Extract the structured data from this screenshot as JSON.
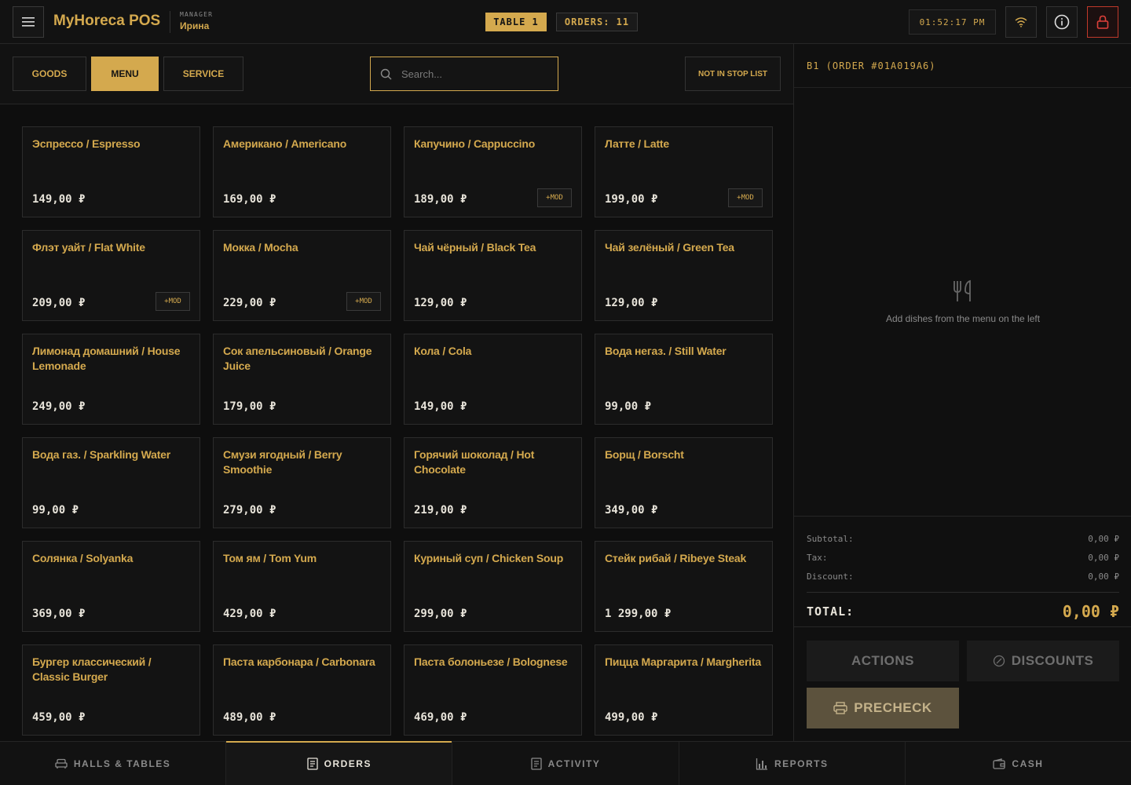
{
  "header": {
    "brand": "MyHoreca POS",
    "role": "MANAGER",
    "user": "Ирина",
    "table": "TABLE 1",
    "orders": "ORDERS: 11",
    "clock": "01:52:17 PM"
  },
  "filters": {
    "categories": [
      "GOODS",
      "MENU",
      "SERVICE"
    ],
    "search_placeholder": "Search...",
    "stop_list": "NOT IN STOP LIST"
  },
  "menu_items": [
    {
      "name": "Эспрессо / Espresso",
      "price": "149,00 ₽",
      "mod": ""
    },
    {
      "name": "Американо / Americano",
      "price": "169,00 ₽",
      "mod": ""
    },
    {
      "name": "Капучино / Cappuccino",
      "price": "189,00 ₽",
      "mod": "+MOD"
    },
    {
      "name": "Латте / Latte",
      "price": "199,00 ₽",
      "mod": "+MOD"
    },
    {
      "name": "Флэт уайт / Flat White",
      "price": "209,00 ₽",
      "mod": "+MOD"
    },
    {
      "name": "Мокка / Mocha",
      "price": "229,00 ₽",
      "mod": "+MOD"
    },
    {
      "name": "Чай чёрный / Black Tea",
      "price": "129,00 ₽",
      "mod": ""
    },
    {
      "name": "Чай зелёный / Green Tea",
      "price": "129,00 ₽",
      "mod": ""
    },
    {
      "name": "Лимонад домашний / House Lemonade",
      "price": "249,00 ₽",
      "mod": ""
    },
    {
      "name": "Сок апельсиновый / Orange Juice",
      "price": "179,00 ₽",
      "mod": ""
    },
    {
      "name": "Кола / Cola",
      "price": "149,00 ₽",
      "mod": ""
    },
    {
      "name": "Вода негаз. / Still Water",
      "price": "99,00 ₽",
      "mod": ""
    },
    {
      "name": "Вода газ. / Sparkling Water",
      "price": "99,00 ₽",
      "mod": ""
    },
    {
      "name": "Смузи ягодный / Berry Smoothie",
      "price": "279,00 ₽",
      "mod": ""
    },
    {
      "name": "Горячий шоколад / Hot Chocolate",
      "price": "219,00 ₽",
      "mod": ""
    },
    {
      "name": "Борщ / Borscht",
      "price": "349,00 ₽",
      "mod": ""
    },
    {
      "name": "Солянка / Solyanka",
      "price": "369,00 ₽",
      "mod": ""
    },
    {
      "name": "Том ям / Tom Yum",
      "price": "429,00 ₽",
      "mod": ""
    },
    {
      "name": "Куриный суп / Chicken Soup",
      "price": "299,00 ₽",
      "mod": ""
    },
    {
      "name": "Стейк рибай / Ribeye Steak",
      "price": "1 299,00 ₽",
      "mod": ""
    },
    {
      "name": "Бургер классический / Classic Burger",
      "price": "459,00 ₽",
      "mod": ""
    },
    {
      "name": "Паста карбонара / Carbonara",
      "price": "489,00 ₽",
      "mod": ""
    },
    {
      "name": "Паста болоньезе / Bolognese",
      "price": "469,00 ₽",
      "mod": ""
    },
    {
      "name": "Пицца Маргарита / Margherita",
      "price": "499,00 ₽",
      "mod": ""
    }
  ],
  "order": {
    "title": "B1 (ORDER #01A019A6)",
    "empty_text": "Add dishes from the menu on the left",
    "subtotal_label": "Subtotal:",
    "subtotal": "0,00 ₽",
    "tax_label": "Tax:",
    "tax": "0,00 ₽",
    "discount_label": "Discount:",
    "discount": "0,00 ₽",
    "total_label": "TOTAL:",
    "total": "0,00 ₽",
    "actions": "ACTIONS",
    "discounts": "DISCOUNTS",
    "precheck": "PRECHECK"
  },
  "nav": [
    "HALLS & TABLES",
    "ORDERS",
    "ACTIVITY",
    "REPORTS",
    "CASH"
  ],
  "colors": {
    "accent": "#d4a94e",
    "background": "#0e0e0e",
    "danger": "#c0392b"
  }
}
